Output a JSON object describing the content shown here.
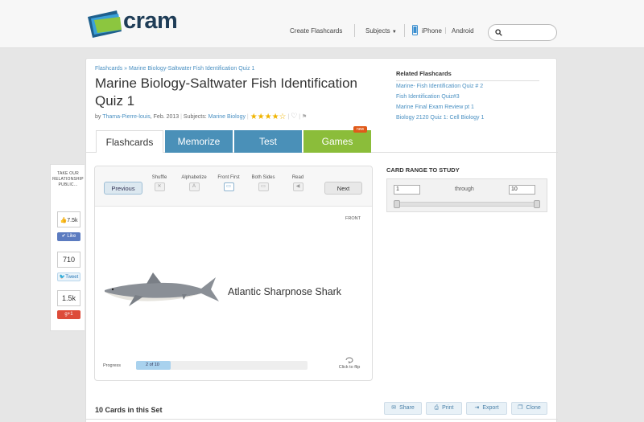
{
  "header": {
    "logo_text": "cram",
    "create_flashcards": "Create Flashcards",
    "subjects": "Subjects",
    "iphone": "iPhone",
    "android": "Android"
  },
  "breadcrumb": "Flashcards » Marine Biology-Saltwater Fish Identification Quiz 1",
  "title": "Marine Biology-Saltwater Fish Identification Quiz 1",
  "meta": {
    "by": "by",
    "author": "Thama-Pierre-louis",
    "date": ", Feb. 2013",
    "subjects_label": "Subjects:",
    "subject": "Marine Biology",
    "stars": "★★★★☆",
    "flag": "⚑"
  },
  "related": {
    "title": "Related Flashcards",
    "items": [
      "Marine- Fish Identification Quiz # 2",
      "Fish Identification Quiz#3",
      "Marine Final Exam Review pt 1",
      "Biology 2120 Quiz 1: Cell Biology 1"
    ]
  },
  "tabs": {
    "flashcards": "Flashcards",
    "memorize": "Memorize",
    "test": "Test",
    "games": "Games",
    "new_badge": "new"
  },
  "player": {
    "previous": "Previous",
    "next": "Next",
    "tools": [
      "Shuffle",
      "Alphabetize",
      "Front First",
      "Both Sides",
      "Read"
    ],
    "side": "FRONT",
    "card_text": "Atlantic Sharpnose Shark",
    "progress_label": "Progress",
    "progress_text": "2 of 10",
    "progress_fraction": 0.2,
    "flip_label": "Click to flip"
  },
  "range": {
    "title": "CARD RANGE TO STUDY",
    "from": "1",
    "through": "through",
    "to": "10"
  },
  "bottom": {
    "count": "10 Cards in this Set",
    "share": "Share",
    "print": "Print",
    "export": "Export",
    "clone": "Clone"
  },
  "social": {
    "text": "TAKE OUR RELATIONSHIP PUBLIC...",
    "likes": "7.5k",
    "like_btn": "Like",
    "tweets": "710",
    "tweet_btn": "Tweet",
    "plus": "1.5k",
    "plus_btn": "+1"
  }
}
